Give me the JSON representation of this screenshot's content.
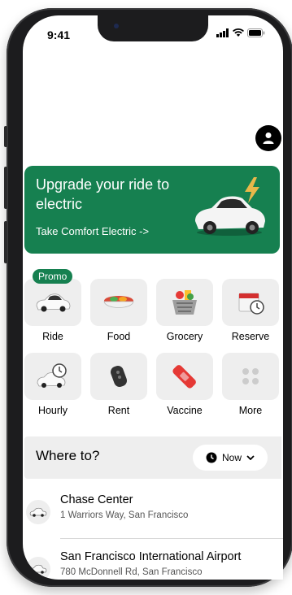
{
  "status_bar": {
    "time": "9:41"
  },
  "banner": {
    "title": "Upgrade your ride to electric",
    "link": "Take Comfort Electric ->",
    "color": "#168050"
  },
  "promo_badge": "Promo",
  "services": [
    {
      "label": "Ride",
      "icon": "car-icon"
    },
    {
      "label": "Food",
      "icon": "food-bowl-icon"
    },
    {
      "label": "Grocery",
      "icon": "grocery-basket-icon"
    },
    {
      "label": "Reserve",
      "icon": "calendar-clock-icon"
    },
    {
      "label": "Hourly",
      "icon": "car-clock-icon"
    },
    {
      "label": "Rent",
      "icon": "car-key-icon"
    },
    {
      "label": "Vaccine",
      "icon": "bandage-icon"
    },
    {
      "label": "More",
      "icon": "grid-dots-icon"
    }
  ],
  "where_to": {
    "label": "Where to?",
    "time_option": "Now"
  },
  "places": [
    {
      "name": "Chase Center",
      "address": "1 Warriors Way, San Francisco"
    },
    {
      "name": "San Francisco International Airport",
      "address": "780 McDonnell Rd, San Francisco"
    }
  ]
}
